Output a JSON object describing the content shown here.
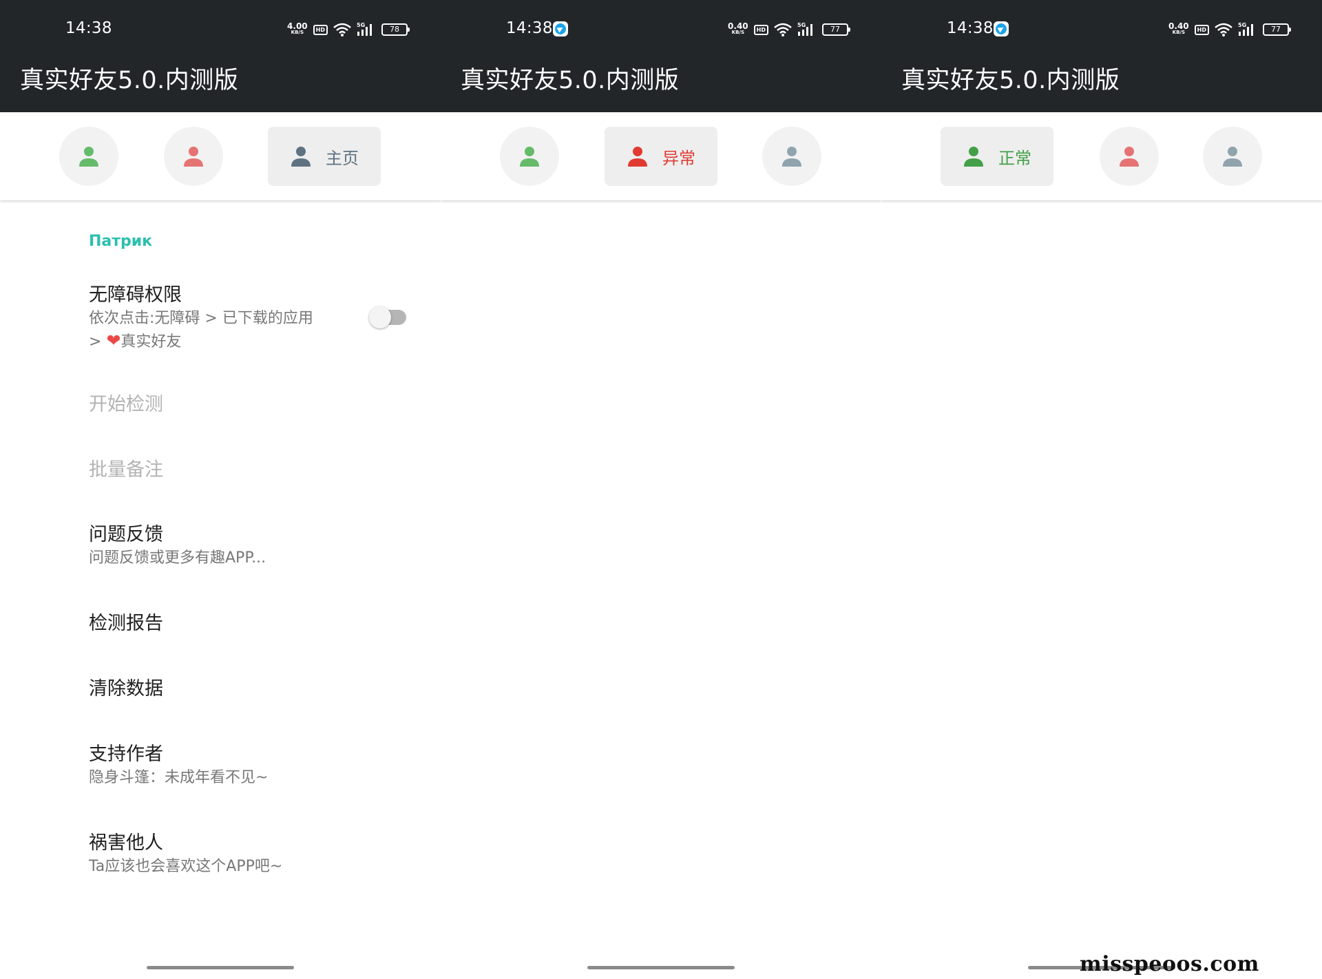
{
  "panels": [
    {
      "status": {
        "time": "14:38",
        "netspeed_value": "4.00",
        "netspeed_unit": "KB/S",
        "hd": "HD",
        "signal": "5G",
        "battery": "78"
      },
      "app_title": "真实好友5.0.内测版",
      "active_tab_label": "主页",
      "active_tab_color": "#5f7282"
    },
    {
      "status": {
        "time": "14:38",
        "netspeed_value": "0.40",
        "netspeed_unit": "KB/S",
        "hd": "HD",
        "signal": "5G",
        "battery": "77"
      },
      "app_title": "真实好友5.0.内测版",
      "active_tab_label": "异常",
      "active_tab_color": "#e13a33"
    },
    {
      "status": {
        "time": "14:38",
        "netspeed_value": "0.40",
        "netspeed_unit": "KB/S",
        "hd": "HD",
        "signal": "5G",
        "battery": "77"
      },
      "app_title": "真实好友5.0.内测版",
      "active_tab_label": "正常",
      "active_tab_color": "#43a047"
    }
  ],
  "tab_icons": {
    "normal": {
      "icon": "person-icon",
      "color": "#66bb6a"
    },
    "abnormal": {
      "icon": "person-icon",
      "color": "#e57373"
    },
    "home": {
      "icon": "person-icon",
      "color": "#90a4ae"
    }
  },
  "home": {
    "section_title": "Патрик",
    "accessibility": {
      "title": "无障碍权限",
      "subtitle_line1": "依次点击:无障碍 > 已下载的应用",
      "subtitle_line2_prefix": ">",
      "subtitle_line2_suffix": "真实好友",
      "heart_icon": "heart-icon",
      "toggle_on": false
    },
    "start_detect": "开始检测",
    "batch_remark": "批量备注",
    "feedback": {
      "title": "问题反馈",
      "subtitle": "问题反馈或更多有趣APP..."
    },
    "report": "检测报告",
    "clear_data": "清除数据",
    "support": {
      "title": "支持作者",
      "subtitle": "隐身斗篷：未成年看不见~"
    },
    "share": {
      "title": "祸害他人",
      "subtitle": "Ta应该也会喜欢这个APP吧~"
    }
  },
  "watermark": "misspeoos.com"
}
